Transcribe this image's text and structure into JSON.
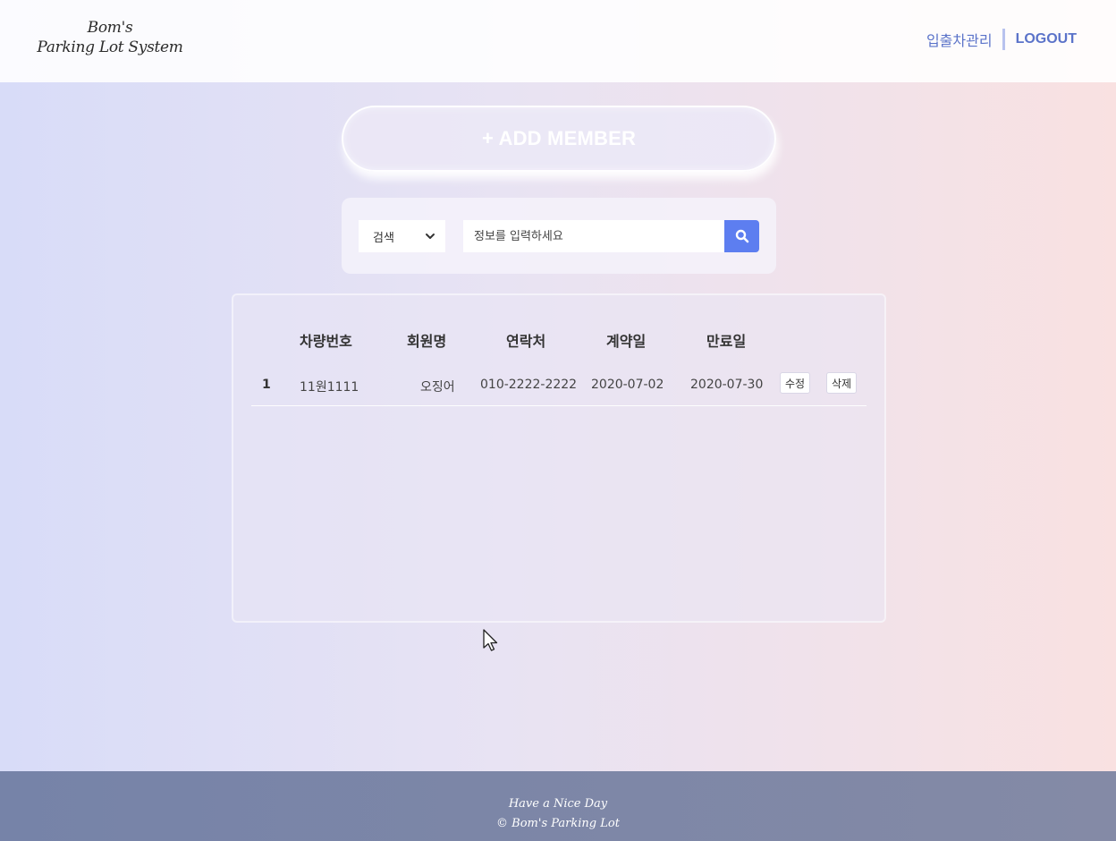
{
  "header": {
    "logo_line1": "Bom's",
    "logo_line2": "Parking Lot System",
    "nav_parking": "입출차관리",
    "nav_logout": "LOGOUT"
  },
  "add_button": {
    "label": "+ ADD MEMBER"
  },
  "search": {
    "select_value": "검색",
    "placeholder": "정보를 입력하세요",
    "button_icon": "search-icon"
  },
  "table": {
    "headers": [
      "",
      "차량번호",
      "회원명",
      "연락처",
      "계약일",
      "만료일"
    ],
    "rows": [
      {
        "no": "1",
        "car_number": "11원1111",
        "member_name": "오징어",
        "contact": "010-2222-2222",
        "contract_date": "2020-07-02",
        "expire_date": "2020-07-30",
        "edit_label": "수정",
        "delete_label": "삭제"
      }
    ]
  },
  "footer": {
    "line1": "Have a Nice Day",
    "line2": "© Bom's Parking Lot"
  },
  "colors": {
    "accent": "#5b73c9",
    "search_button": "#5d7ef0",
    "footer": "#7d86a8"
  }
}
